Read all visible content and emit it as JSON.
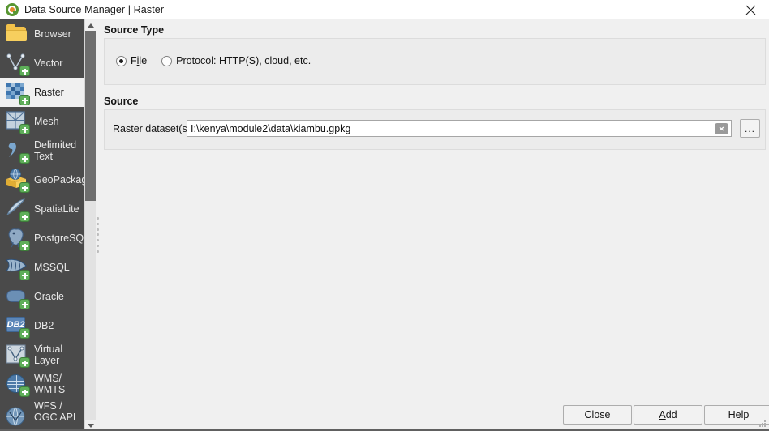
{
  "window": {
    "title": "Data Source Manager | Raster",
    "logo_icon": "qgis-logo-icon",
    "close_icon": "close-icon"
  },
  "sidebar": {
    "selected": "Raster",
    "items": [
      {
        "label": "Browser",
        "icon": "folder-icon"
      },
      {
        "label": "Vector",
        "icon": "vector-layer-icon"
      },
      {
        "label": "Raster",
        "icon": "raster-layer-icon"
      },
      {
        "label": "Mesh",
        "icon": "mesh-layer-icon"
      },
      {
        "label": "Delimited Text",
        "icon": "delimited-text-icon"
      },
      {
        "label": "GeoPackage",
        "icon": "geopackage-icon"
      },
      {
        "label": "SpatiaLite",
        "icon": "spatialite-icon"
      },
      {
        "label": "PostgreSQL",
        "icon": "postgresql-icon"
      },
      {
        "label": "MSSQL",
        "icon": "mssql-icon"
      },
      {
        "label": "Oracle",
        "icon": "oracle-icon"
      },
      {
        "label": "DB2",
        "icon": "db2-icon"
      },
      {
        "label": "Virtual Layer",
        "icon": "virtual-layer-icon"
      },
      {
        "label": "WMS/ WMTS",
        "icon": "wms-wmts-icon"
      },
      {
        "label": "WFS / OGC API -",
        "icon": "wfs-ogc-api-icon"
      }
    ],
    "scrollbar": {
      "up_icon": "scroll-up-arrow-icon",
      "down_icon": "scroll-down-arrow-icon"
    }
  },
  "source_type": {
    "group_label": "Source Type",
    "options": [
      {
        "label": "File",
        "checked": true
      },
      {
        "label": "Protocol: HTTP(S), cloud, etc.",
        "checked": false
      }
    ]
  },
  "source": {
    "group_label": "Source",
    "field_label": "Raster dataset(s)",
    "value": "I:\\kenya\\module2\\data\\kiambu.gpkg",
    "placeholder": "",
    "clear_icon": "clear-text-icon",
    "browse_label": "...",
    "browse_icon": "browse-ellipsis-icon"
  },
  "buttons": {
    "close": "Close",
    "add": "Add",
    "help": "Help"
  },
  "colors": {
    "sidebar_bg": "#4a4a4a",
    "panel_bg": "#f0f0f0",
    "group_bg": "#ececec",
    "selected_item_bg": "#f0f0f0",
    "accent_green": "#589632",
    "accent_orange": "#e58a2d",
    "badge_green": "#5faf5a"
  }
}
